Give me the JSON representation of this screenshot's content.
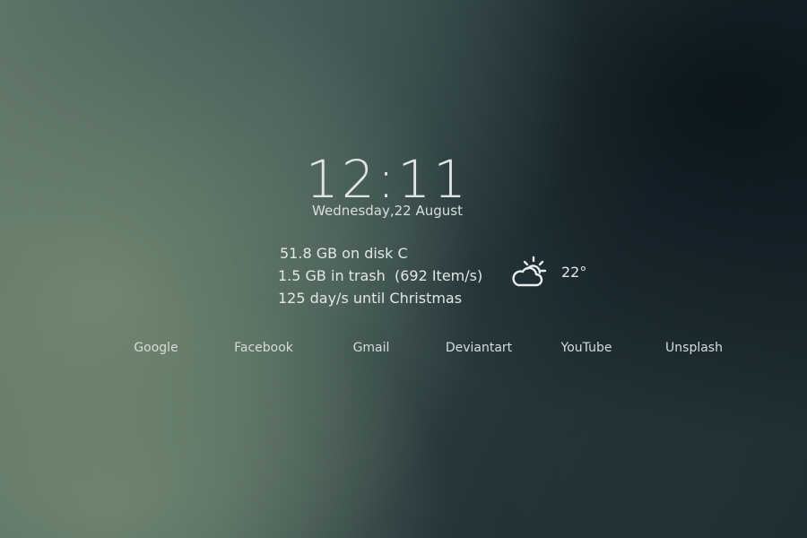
{
  "clock": {
    "time": "12:11",
    "date": "Wednesday,22 August"
  },
  "info": {
    "disk": "51.8 GB on disk C",
    "trash": "1.5 GB in trash  (692 Item/s)",
    "countdown": "125 day/s until Christmas"
  },
  "weather": {
    "icon": "partly-cloudy-icon",
    "temperature": "22°"
  },
  "links": [
    {
      "label": "Google"
    },
    {
      "label": "Facebook"
    },
    {
      "label": "Gmail"
    },
    {
      "label": "Deviantart"
    },
    {
      "label": "YouTube"
    },
    {
      "label": "Unsplash"
    }
  ]
}
